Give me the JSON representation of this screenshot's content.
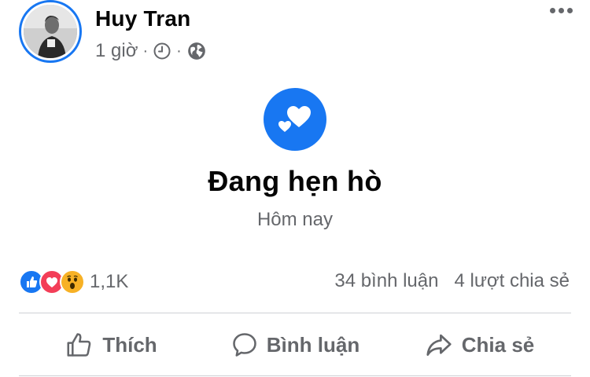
{
  "post": {
    "author": "Huy Tran",
    "time": "1 giờ",
    "separator": "·",
    "icons": [
      "clock-icon",
      "globe-icon",
      "more-options-icon"
    ]
  },
  "event": {
    "icon": "hearts-icon",
    "title": "Đang hẹn hò",
    "date": "Hôm nay"
  },
  "reactions": {
    "types": [
      "like",
      "love",
      "wow"
    ],
    "count": "1,1K"
  },
  "stats": {
    "comments": "34 bình luận",
    "shares": "4 lượt chia sẻ"
  },
  "actions": {
    "like": "Thích",
    "comment": "Bình luận",
    "share": "Chia sẻ"
  },
  "colors": {
    "accent": "#1877f2",
    "love": "#f33e58",
    "wow": "#f7b125",
    "secondary_text": "#65676b"
  }
}
